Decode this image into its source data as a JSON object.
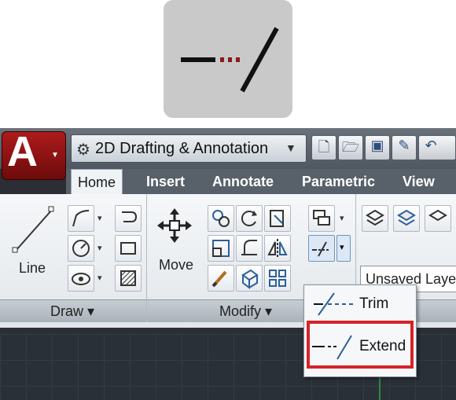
{
  "workspace": {
    "name": "2D Drafting & Annotation"
  },
  "tabs": [
    {
      "label": "Home",
      "active": true
    },
    {
      "label": "Insert"
    },
    {
      "label": "Annotate"
    },
    {
      "label": "Parametric"
    },
    {
      "label": "View"
    }
  ],
  "draw_panel": {
    "line_label": "Line",
    "panel_label": "Draw ▾"
  },
  "modify_panel": {
    "move_label": "Move",
    "panel_label": "Modify ▾"
  },
  "layers": {
    "current_layer": "Unsaved Laye"
  },
  "flyout": {
    "items": [
      {
        "label": "Trim",
        "icon": "trim-icon"
      },
      {
        "label": "Extend",
        "icon": "extend-icon",
        "highlighted": true
      }
    ]
  },
  "colors": {
    "app_red": "#a71a1a",
    "highlight_red": "#d6222a",
    "dark_red_dots": "#8b1a1a"
  }
}
